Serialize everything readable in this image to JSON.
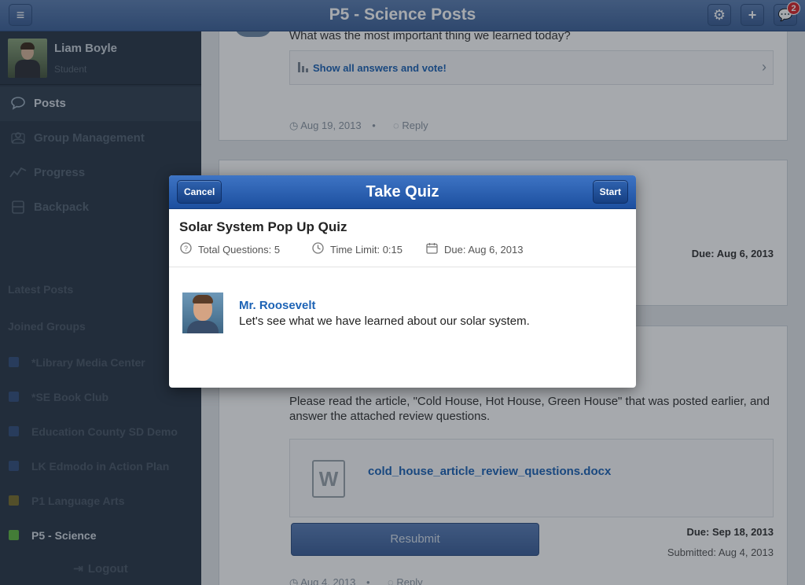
{
  "header": {
    "title": "P5 - Science Posts",
    "notification_count": "2"
  },
  "sidebar": {
    "user": {
      "name": "Liam  Boyle",
      "role": "Student"
    },
    "nav": [
      {
        "label": "Posts",
        "icon": "speech-bubble-icon"
      },
      {
        "label": "Group Management",
        "icon": "groups-icon"
      },
      {
        "label": "Progress",
        "icon": "progress-chart-icon"
      },
      {
        "label": "Backpack",
        "icon": "backpack-icon"
      }
    ],
    "latest_posts": "Latest Posts",
    "joined_groups": "Joined Groups",
    "groups": [
      {
        "label": "*Library Media Center",
        "color": "#3d6db0"
      },
      {
        "label": "*SE Book Club",
        "color": "#3d6db0"
      },
      {
        "label": "Education County SD Demo",
        "color": "#3d6db0"
      },
      {
        "label": "LK Edmodo in Action Plan",
        "color": "#3d6db0"
      },
      {
        "label": "P1 Language Arts",
        "color": "#c9b531"
      },
      {
        "label": "P5 - Science",
        "color": "#5fb641"
      }
    ],
    "logout": "Logout"
  },
  "posts": {
    "poll": {
      "question": "What was the most important thing we learned today?",
      "show_answers": "Show all answers and vote!",
      "date": "Aug 19, 2013",
      "reply": "Reply"
    },
    "quiz_card": {
      "due": "Due: Aug 6, 2013"
    },
    "assignment": {
      "text": "Please read the article, \"Cold House, Hot House, Green House\" that was posted earlier, and answer the attached review questions.",
      "file": "cold_house_article_review_questions.docx",
      "file_icon_letter": "W",
      "resubmit": "Resubmit",
      "due": "Due: Sep 18, 2013",
      "submitted": "Submitted: Aug 4, 2013",
      "date": "Aug 4, 2013",
      "reply": "Reply"
    }
  },
  "modal": {
    "title": "Take Quiz",
    "cancel": "Cancel",
    "start": "Start",
    "quiz_name": "Solar System Pop Up Quiz",
    "total_questions": "Total Questions: 5",
    "time_limit": "Time Limit: 0:15",
    "due": "Due: Aug 6, 2013",
    "teacher": "Mr. Roosevelt",
    "message": "Let's see what we have learned about our solar system."
  }
}
